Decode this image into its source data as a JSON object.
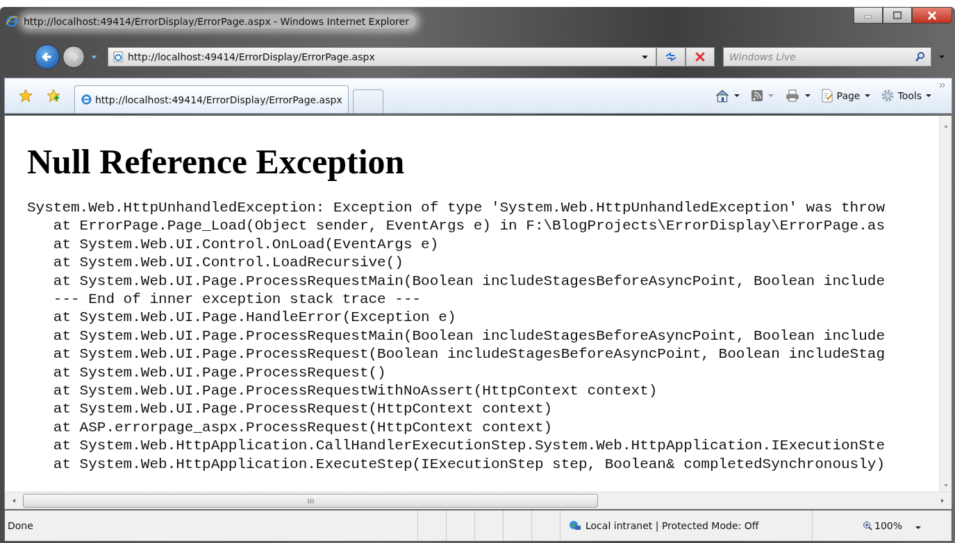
{
  "window": {
    "title": "http://localhost:49414/ErrorDisplay/ErrorPage.aspx - Windows Internet Explorer"
  },
  "address_bar": {
    "url": "http://localhost:49414/ErrorDisplay/ErrorPage.aspx"
  },
  "search": {
    "placeholder": "Windows Live"
  },
  "tabs": [
    {
      "label": "http://localhost:49414/ErrorDisplay/ErrorPage.aspx",
      "selected": true
    }
  ],
  "command_bar": [
    {
      "kind": "home"
    },
    {
      "kind": "feeds"
    },
    {
      "kind": "print"
    },
    {
      "kind": "page",
      "label": "Page"
    },
    {
      "kind": "tools",
      "label": "Tools"
    }
  ],
  "page": {
    "heading": "Null Reference Exception",
    "trace": [
      "System.Web.HttpUnhandledException: Exception of type 'System.Web.HttpUnhandledException' was throw",
      "   at ErrorPage.Page_Load(Object sender, EventArgs e) in F:\\BlogProjects\\ErrorDisplay\\ErrorPage.as",
      "   at System.Web.UI.Control.OnLoad(EventArgs e)",
      "   at System.Web.UI.Control.LoadRecursive()",
      "   at System.Web.UI.Page.ProcessRequestMain(Boolean includeStagesBeforeAsyncPoint, Boolean include",
      "   --- End of inner exception stack trace ---",
      "   at System.Web.UI.Page.HandleError(Exception e)",
      "   at System.Web.UI.Page.ProcessRequestMain(Boolean includeStagesBeforeAsyncPoint, Boolean include",
      "   at System.Web.UI.Page.ProcessRequest(Boolean includeStagesBeforeAsyncPoint, Boolean includeStag",
      "   at System.Web.UI.Page.ProcessRequest()",
      "   at System.Web.UI.Page.ProcessRequestWithNoAssert(HttpContext context)",
      "   at System.Web.UI.Page.ProcessRequest(HttpContext context)",
      "   at ASP.errorpage_aspx.ProcessRequest(HttpContext context)",
      "   at System.Web.HttpApplication.CallHandlerExecutionStep.System.Web.HttpApplication.IExecutionSte",
      "   at System.Web.HttpApplication.ExecuteStep(IExecutionStep step, Boolean& completedSynchronously)"
    ]
  },
  "status_bar": {
    "text": "Done",
    "zone": "Local intranet | Protected Mode: Off",
    "zoom": "100%"
  }
}
